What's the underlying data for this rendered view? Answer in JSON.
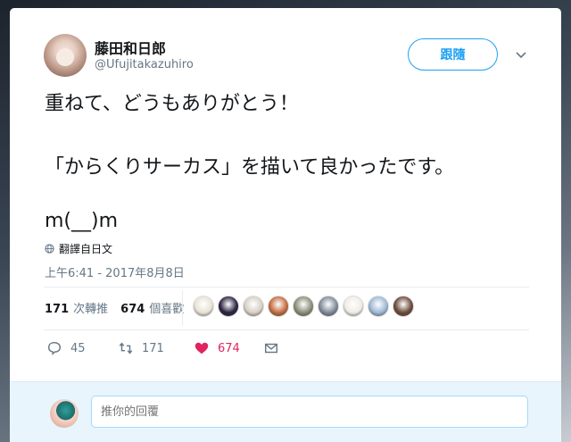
{
  "user": {
    "display_name": "藤田和日郎",
    "handle": "@Ufujitakazuhiro"
  },
  "follow_button": {
    "label": "跟隨"
  },
  "tweet": {
    "line1": "重ねて、どうもありがとう！",
    "line2": "「からくりサーカス」を描いて良かったです。",
    "line3": "m(__)m",
    "translate_label": "翻譯自日文",
    "timestamp": "上午6:41 - 2017年8月8日"
  },
  "stats": {
    "retweet_count": "171",
    "retweet_label": "次轉推",
    "like_count": "674",
    "like_label": "個喜歡"
  },
  "liker_avatars": [
    {
      "icon": "avatar-1",
      "color": "#e9e3d6"
    },
    {
      "icon": "avatar-2",
      "color": "#2b2240"
    },
    {
      "icon": "avatar-3",
      "color": "#d7d0c5"
    },
    {
      "icon": "avatar-4",
      "color": "#c46a3e"
    },
    {
      "icon": "avatar-5",
      "color": "#8a8d78"
    },
    {
      "icon": "avatar-6",
      "color": "#7f8a98"
    },
    {
      "icon": "avatar-7",
      "color": "#f0ece6"
    },
    {
      "icon": "avatar-8",
      "color": "#9db8d6"
    },
    {
      "icon": "avatar-9",
      "color": "#6c4a3a"
    }
  ],
  "actions": {
    "reply_count": "45",
    "retweet_count": "171",
    "like_count": "674"
  },
  "reply": {
    "placeholder": "推你的回覆"
  },
  "colors": {
    "accent": "#1da1f2",
    "like": "#e0245e",
    "muted": "#657786"
  }
}
